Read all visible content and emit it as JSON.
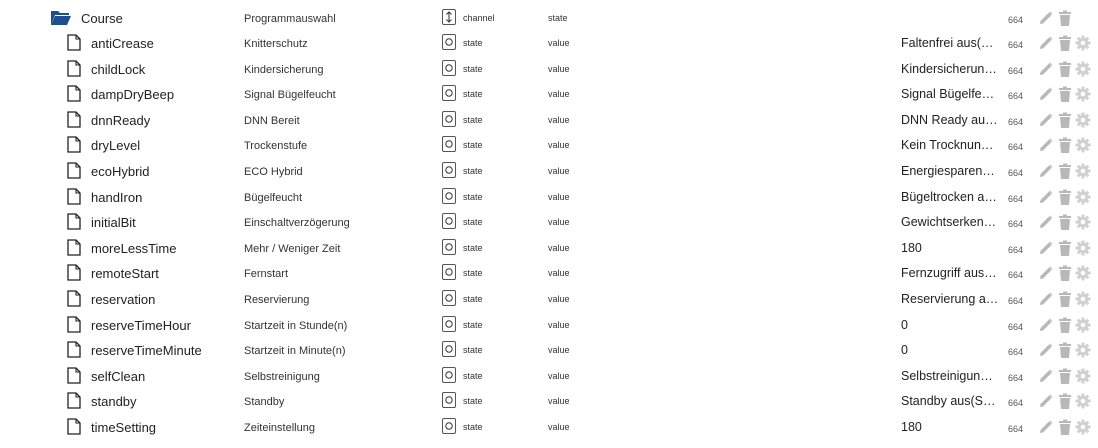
{
  "colors": {
    "folder": "#1f4e8c",
    "action_icon": "#b8b8b8",
    "gear": "#d0d0d0"
  },
  "icons": {
    "folder": "folder-open-icon",
    "file": "file-icon",
    "channel": "channel-icon",
    "state": "state-icon",
    "edit": "pencil-icon",
    "delete": "trash-icon",
    "settings": "gear-icon"
  },
  "folder": {
    "name": "Course",
    "desc": "Programmauswahl",
    "type": "channel",
    "role": "state",
    "acl": "664"
  },
  "rows": [
    {
      "name": "antiCrease",
      "desc": "Knitterschutz",
      "type": "state",
      "role": "value",
      "value": "Faltenfrei aus(…",
      "acl": "664"
    },
    {
      "name": "childLock",
      "desc": "Kindersicherung",
      "type": "state",
      "role": "value",
      "value": "Kindersicherun…",
      "acl": "664"
    },
    {
      "name": "dampDryBeep",
      "desc": "Signal Bügelfeucht",
      "type": "state",
      "role": "value",
      "value": "Signal Bügelfe…",
      "acl": "664"
    },
    {
      "name": "dnnReady",
      "desc": "DNN Bereit",
      "type": "state",
      "role": "value",
      "value": "DNN Ready au…",
      "acl": "664"
    },
    {
      "name": "dryLevel",
      "desc": "Trockenstufe",
      "type": "state",
      "role": "value",
      "value": "Kein Trocknun…",
      "acl": "664"
    },
    {
      "name": "ecoHybrid",
      "desc": "ECO Hybrid",
      "type": "state",
      "role": "value",
      "value": "Energiesparen…",
      "acl": "664"
    },
    {
      "name": "handIron",
      "desc": "Bügelfeucht",
      "type": "state",
      "role": "value",
      "value": "Bügeltrocken a…",
      "acl": "664"
    },
    {
      "name": "initialBit",
      "desc": "Einschaltverzögerung",
      "type": "state",
      "role": "value",
      "value": "Gewichtserken…",
      "acl": "664"
    },
    {
      "name": "moreLessTime",
      "desc": "Mehr / Weniger Zeit",
      "type": "state",
      "role": "value",
      "value": "180",
      "acl": "664"
    },
    {
      "name": "remoteStart",
      "desc": "Fernstart",
      "type": "state",
      "role": "value",
      "value": "Fernzugriff aus…",
      "acl": "664"
    },
    {
      "name": "reservation",
      "desc": "Reservierung",
      "type": "state",
      "role": "value",
      "value": "Reservierung a…",
      "acl": "664"
    },
    {
      "name": "reserveTimeHour",
      "desc": "Startzeit in Stunde(n)",
      "type": "state",
      "role": "value",
      "value": "0",
      "acl": "664"
    },
    {
      "name": "reserveTimeMinute",
      "desc": "Startzeit in Minute(n)",
      "type": "state",
      "role": "value",
      "value": "0",
      "acl": "664"
    },
    {
      "name": "selfClean",
      "desc": "Selbstreinigung",
      "type": "state",
      "role": "value",
      "value": "Selbstreinigun…",
      "acl": "664"
    },
    {
      "name": "standby",
      "desc": "Standby",
      "type": "state",
      "role": "value",
      "value": "Standby aus(S…",
      "acl": "664"
    },
    {
      "name": "timeSetting",
      "desc": "Zeiteinstellung",
      "type": "state",
      "role": "value",
      "value": "180",
      "acl": "664"
    }
  ]
}
